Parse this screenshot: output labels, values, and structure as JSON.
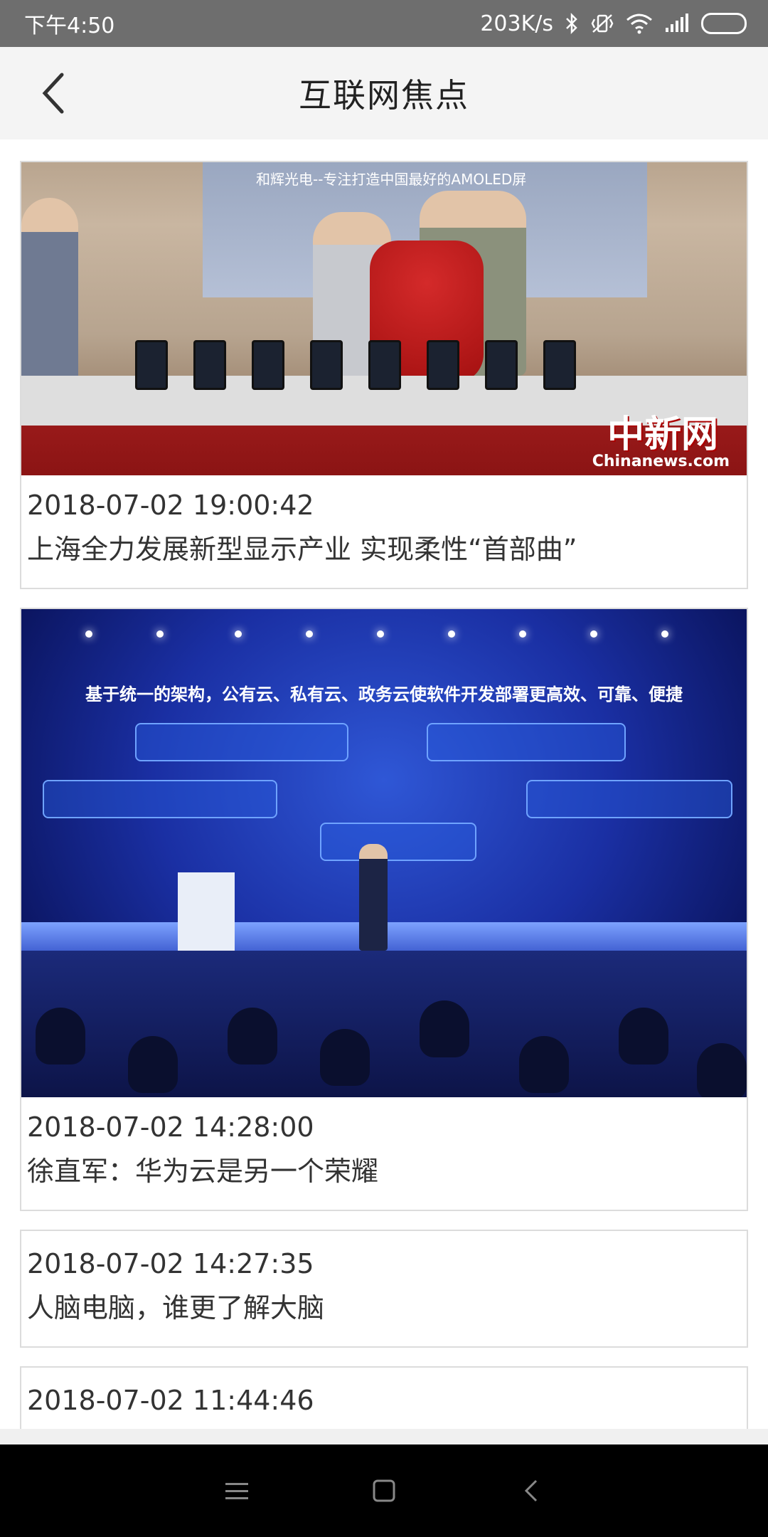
{
  "status_bar": {
    "time": "下午4:50",
    "network_speed": "203K/s",
    "icons": [
      "bluetooth-icon",
      "vibrate-icon",
      "wifi-icon",
      "signal-icon",
      "battery-icon"
    ]
  },
  "header": {
    "title": "互联网焦点",
    "back_icon": "chevron-left-icon"
  },
  "articles": [
    {
      "date": "2018-07-02 19:00:42",
      "headline": "上海全力发展新型显示产业 实现柔性“首部曲”",
      "has_image": true,
      "image_text": {
        "banner": "和辉光电--专注打造中国最好的AMOLED屏",
        "watermark": "中新网",
        "watermark_sub": "Chinanews.com"
      }
    },
    {
      "date": "2018-07-02 14:28:00",
      "headline": "徐直军：华为云是另一个荣耀",
      "has_image": true,
      "image_text": {
        "slide_title": "基于统一的架构，公有云、私有云、政务云使软件开发部署更高效、可靠、便捷"
      }
    },
    {
      "date": "2018-07-02 14:27:35",
      "headline": "人脑电脑，谁更了解大脑",
      "has_image": false
    },
    {
      "date": "2018-07-02 11:44:46",
      "headline": "",
      "has_image": false
    }
  ],
  "nav_bar": {
    "icons": [
      "menu-icon",
      "home-square-icon",
      "back-triangle-icon"
    ]
  }
}
